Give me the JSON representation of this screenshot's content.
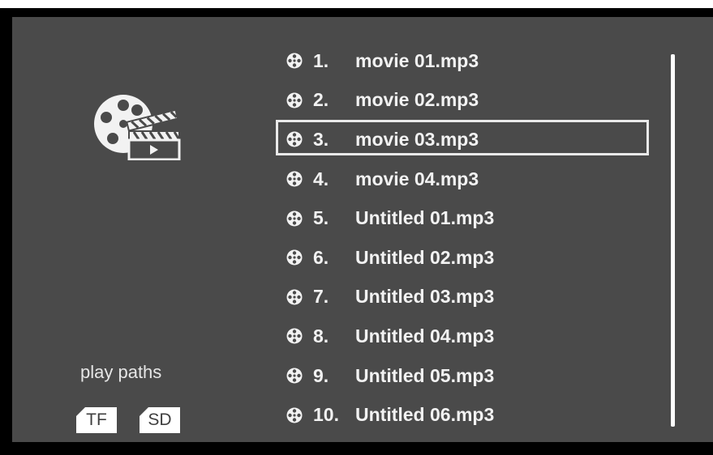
{
  "sidebar": {
    "media_icon": "film-reel-clapperboard-icon",
    "play_paths_label": "play paths",
    "sources": [
      {
        "label": "TF"
      },
      {
        "label": "SD"
      }
    ]
  },
  "file_list": {
    "selected_index": 2,
    "items": [
      {
        "number": "1.",
        "name": "movie 01.mp3"
      },
      {
        "number": "2.",
        "name": "movie 02.mp3"
      },
      {
        "number": "3.",
        "name": "movie 03.mp3"
      },
      {
        "number": "4.",
        "name": "movie 04.mp3"
      },
      {
        "number": "5.",
        "name": "Untitled 01.mp3"
      },
      {
        "number": "6.",
        "name": "Untitled 02.mp3"
      },
      {
        "number": "7.",
        "name": "Untitled 03.mp3"
      },
      {
        "number": "8.",
        "name": "Untitled 04.mp3"
      },
      {
        "number": "9.",
        "name": "Untitled 05.mp3"
      },
      {
        "number": "10.",
        "name": "Untitled 06.mp3"
      }
    ]
  },
  "colors": {
    "panel_background": "#4a4a4a",
    "frame": "#000000",
    "text": "#f2f2f2",
    "highlight_border": "#e9e9e9"
  }
}
